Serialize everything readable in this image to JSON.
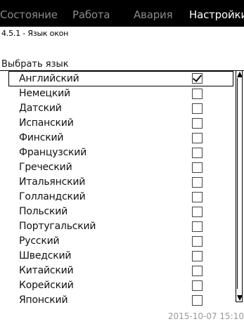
{
  "tabs": [
    {
      "label": "Состояние",
      "active": false
    },
    {
      "label": "Работа",
      "active": false
    },
    {
      "label": "Авария",
      "active": false
    },
    {
      "label": "Настройки",
      "active": true
    }
  ],
  "menu_title": "4.5.1 - Язык окон",
  "section_label": "Выбрать язык",
  "languages": [
    {
      "label": "Английский",
      "checked": true
    },
    {
      "label": "Немецкий",
      "checked": false
    },
    {
      "label": "Датский",
      "checked": false
    },
    {
      "label": "Испанский",
      "checked": false
    },
    {
      "label": "Финский",
      "checked": false
    },
    {
      "label": "Французский",
      "checked": false
    },
    {
      "label": "Греческий",
      "checked": false
    },
    {
      "label": "Итальянский",
      "checked": false
    },
    {
      "label": "Голландский",
      "checked": false
    },
    {
      "label": "Польский",
      "checked": false
    },
    {
      "label": "Португальский",
      "checked": false
    },
    {
      "label": "Русский",
      "checked": false
    },
    {
      "label": "Шведский",
      "checked": false
    },
    {
      "label": "Китайский",
      "checked": false
    },
    {
      "label": "Корейский",
      "checked": false
    },
    {
      "label": "Японский",
      "checked": false
    }
  ],
  "selected_index": 0,
  "datetime": "2015-10-07 15:10"
}
